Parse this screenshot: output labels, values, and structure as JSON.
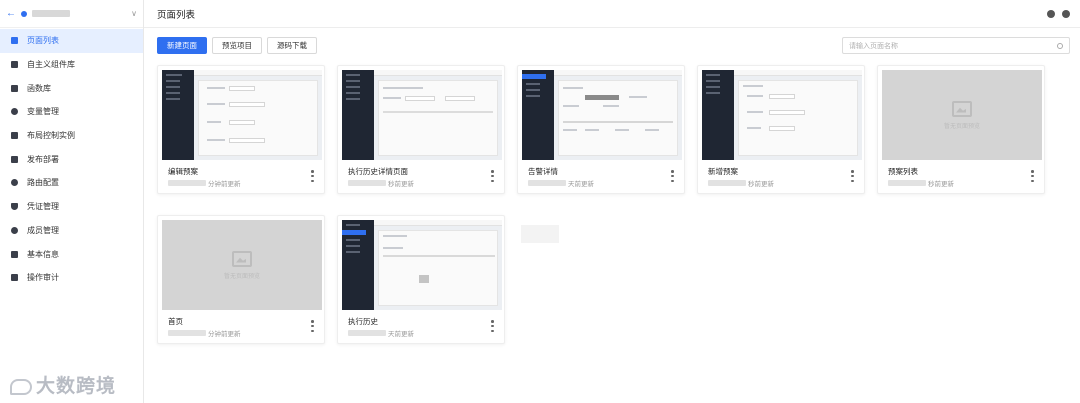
{
  "sidebar": {
    "items": [
      {
        "label": "页面列表",
        "icon": "folder-icon",
        "active": true
      },
      {
        "label": "自主义组件库",
        "icon": "component-icon"
      },
      {
        "label": "函数库",
        "icon": "folder-icon"
      },
      {
        "label": "变量管理",
        "icon": "variable-icon"
      },
      {
        "label": "布局控制实例",
        "icon": "layout-icon"
      },
      {
        "label": "发布部署",
        "icon": "folder-icon"
      },
      {
        "label": "路由配置",
        "icon": "route-icon"
      },
      {
        "label": "凭证管理",
        "icon": "shield-icon"
      },
      {
        "label": "成员管理",
        "icon": "member-icon"
      },
      {
        "label": "基本信息",
        "icon": "info-icon"
      },
      {
        "label": "操作审计",
        "icon": "audit-icon"
      }
    ]
  },
  "watermark": "大数跨境",
  "header": {
    "title": "页面列表"
  },
  "toolbar": {
    "new_page": "新建页面",
    "preview_project": "预览项目",
    "source_download": "源码下载"
  },
  "search": {
    "placeholder": "请输入页面名称"
  },
  "cards": [
    {
      "name": "编辑预案",
      "meta": "分钟前更新",
      "thumb": "screenshot"
    },
    {
      "name": "执行历史详情页面",
      "meta": "秒前更新",
      "thumb": "screenshot"
    },
    {
      "name": "告警详情",
      "meta": "天前更新",
      "thumb": "screenshot"
    },
    {
      "name": "新增预案",
      "meta": "秒前更新",
      "thumb": "screenshot"
    },
    {
      "name": "预案列表",
      "meta": "秒前更新",
      "thumb": "placeholder"
    },
    {
      "name": "首页",
      "meta": "分钟前更新",
      "thumb": "placeholder"
    },
    {
      "name": "执行历史",
      "meta": "天前更新",
      "thumb": "screenshot"
    }
  ],
  "placeholder_text": "暂无页面预览"
}
